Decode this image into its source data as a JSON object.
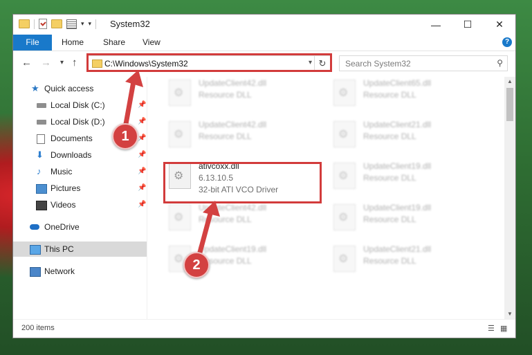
{
  "window": {
    "title": "System32",
    "controls": {
      "minimize": "—",
      "maximize": "☐",
      "close": "✕"
    }
  },
  "ribbon": {
    "tabs": [
      "File",
      "Home",
      "Share",
      "View"
    ],
    "help": "?"
  },
  "nav": {
    "back": "←",
    "forward": "→",
    "recent": "▾",
    "up": "↑",
    "address": "C:\\Windows\\System32",
    "address_dropdown": "▾",
    "refresh": "↻",
    "search_placeholder": "Search System32",
    "search_icon": "⚲"
  },
  "sidebar": {
    "items": [
      {
        "label": "Quick access",
        "icon": "star-icon",
        "pinned": false
      },
      {
        "label": "Local Disk (C:)",
        "icon": "drive-icon",
        "pinned": true
      },
      {
        "label": "Local Disk (D:)",
        "icon": "drive-icon",
        "pinned": true
      },
      {
        "label": "Documents",
        "icon": "documents-icon",
        "pinned": true
      },
      {
        "label": "Downloads",
        "icon": "download-icon",
        "pinned": true
      },
      {
        "label": "Music",
        "icon": "music-icon",
        "pinned": true
      },
      {
        "label": "Pictures",
        "icon": "pictures-icon",
        "pinned": true
      },
      {
        "label": "Videos",
        "icon": "videos-icon",
        "pinned": true
      },
      {
        "label": "OneDrive",
        "icon": "cloud-icon",
        "pinned": false
      },
      {
        "label": "This PC",
        "icon": "computer-icon",
        "pinned": false,
        "selected": true
      },
      {
        "label": "Network",
        "icon": "network-icon",
        "pinned": false
      }
    ],
    "pin_glyph": "📌"
  },
  "files": {
    "highlighted": {
      "name": "ativcoxx.dll",
      "version": "6.13.10.5",
      "description": "32-bit ATI VCO Driver"
    },
    "blurred_left": [
      {
        "name": "UpdateClient42.dll",
        "type": "Resource DLL"
      },
      {
        "name": "UpdateClient42.dll",
        "type": "Resource DLL"
      },
      {
        "name": "UpdateClient42.dll",
        "type": "Resource DLL"
      },
      {
        "name": "UpdateClient19.dll",
        "type": "Resource DLL"
      }
    ],
    "blurred_right": [
      {
        "name": "UpdateClient65.dll",
        "type": "Resource DLL"
      },
      {
        "name": "UpdateClient21.dll",
        "type": "Resource DLL"
      },
      {
        "name": "UpdateClient19.dll",
        "type": "Resource DLL"
      },
      {
        "name": "UpdateClient19.dll",
        "type": "Resource DLL"
      },
      {
        "name": "UpdateClient21.dll",
        "type": "Resource DLL"
      }
    ]
  },
  "status": {
    "item_count": "200 items"
  },
  "annotations": {
    "step1": "1",
    "step2": "2",
    "accent_color": "#d34141"
  }
}
